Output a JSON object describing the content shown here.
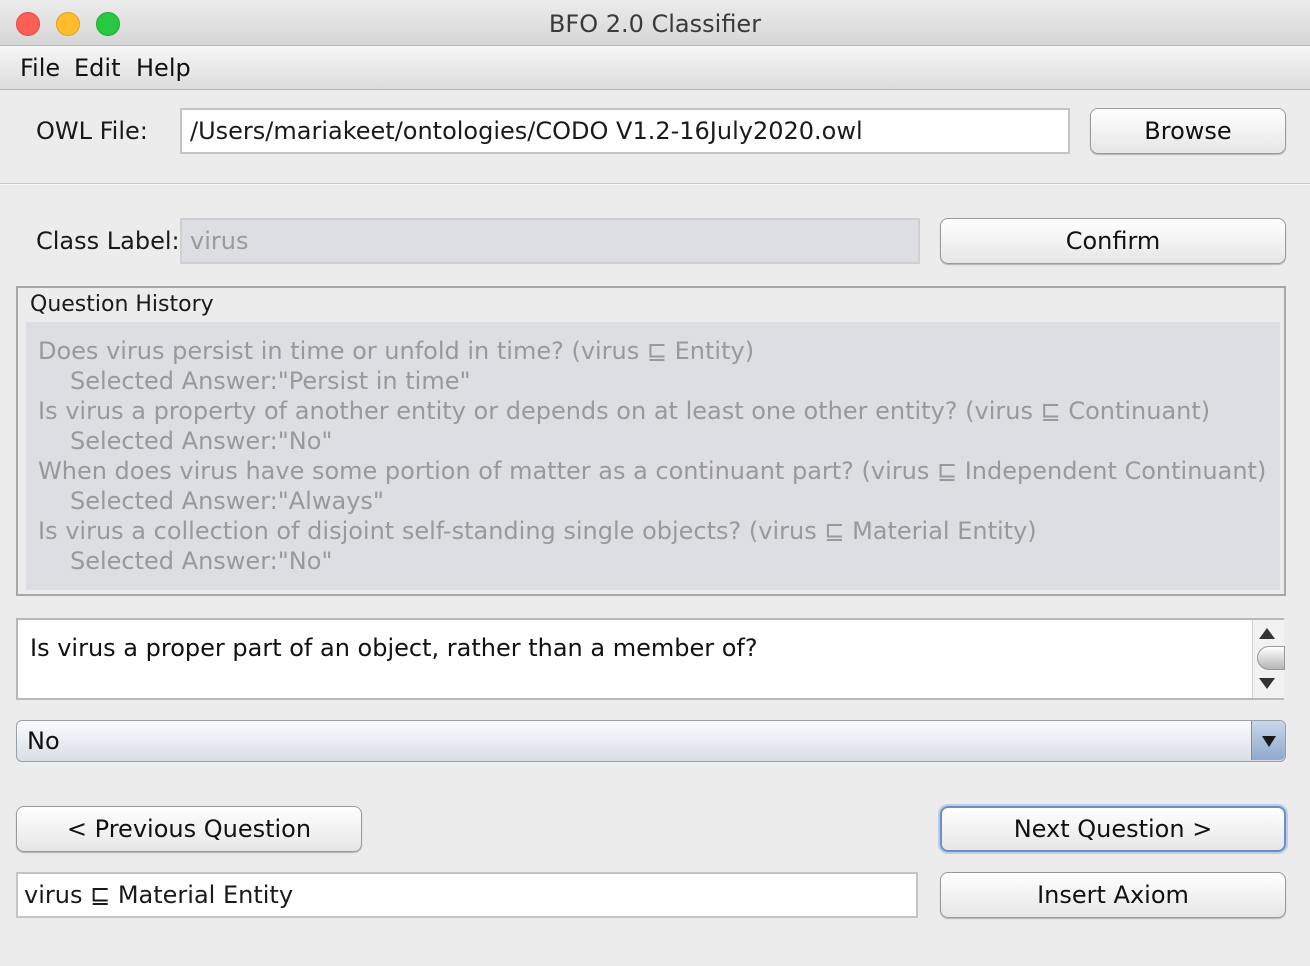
{
  "window": {
    "title": "BFO 2.0 Classifier"
  },
  "menu": {
    "file": "File",
    "edit": "Edit",
    "help": "Help"
  },
  "owl_file": {
    "label": "OWL File:",
    "value": "/Users/mariakeet/ontologies/CODO V1.2-16July2020.owl",
    "browse_label": "Browse"
  },
  "class_label": {
    "label": "Class Label:",
    "value": "virus",
    "confirm_label": "Confirm"
  },
  "history": {
    "title": "Question History",
    "lines": [
      "Does virus persist in time or unfold in time? (virus ⊑ Entity)",
      "Selected Answer:\"Persist in time\"",
      "Is virus a property of another entity or depends on at least one other entity? (virus ⊑ Continuant)",
      "Selected Answer:\"No\"",
      "When does virus have some portion of matter as a continuant part? (virus ⊑ Independent Continuant)",
      "Selected Answer:\"Always\"",
      "Is virus a collection of disjoint self-standing single objects? (virus ⊑ Material Entity)",
      "Selected Answer:\"No\""
    ]
  },
  "question": {
    "text": "Is virus a proper part of an object, rather than a member of?"
  },
  "answer": {
    "selected": "No"
  },
  "nav": {
    "previous_label": "< Previous Question",
    "next_label": "Next Question >"
  },
  "axiom": {
    "value": "virus ⊑ Material Entity",
    "insert_label": "Insert Axiom"
  }
}
